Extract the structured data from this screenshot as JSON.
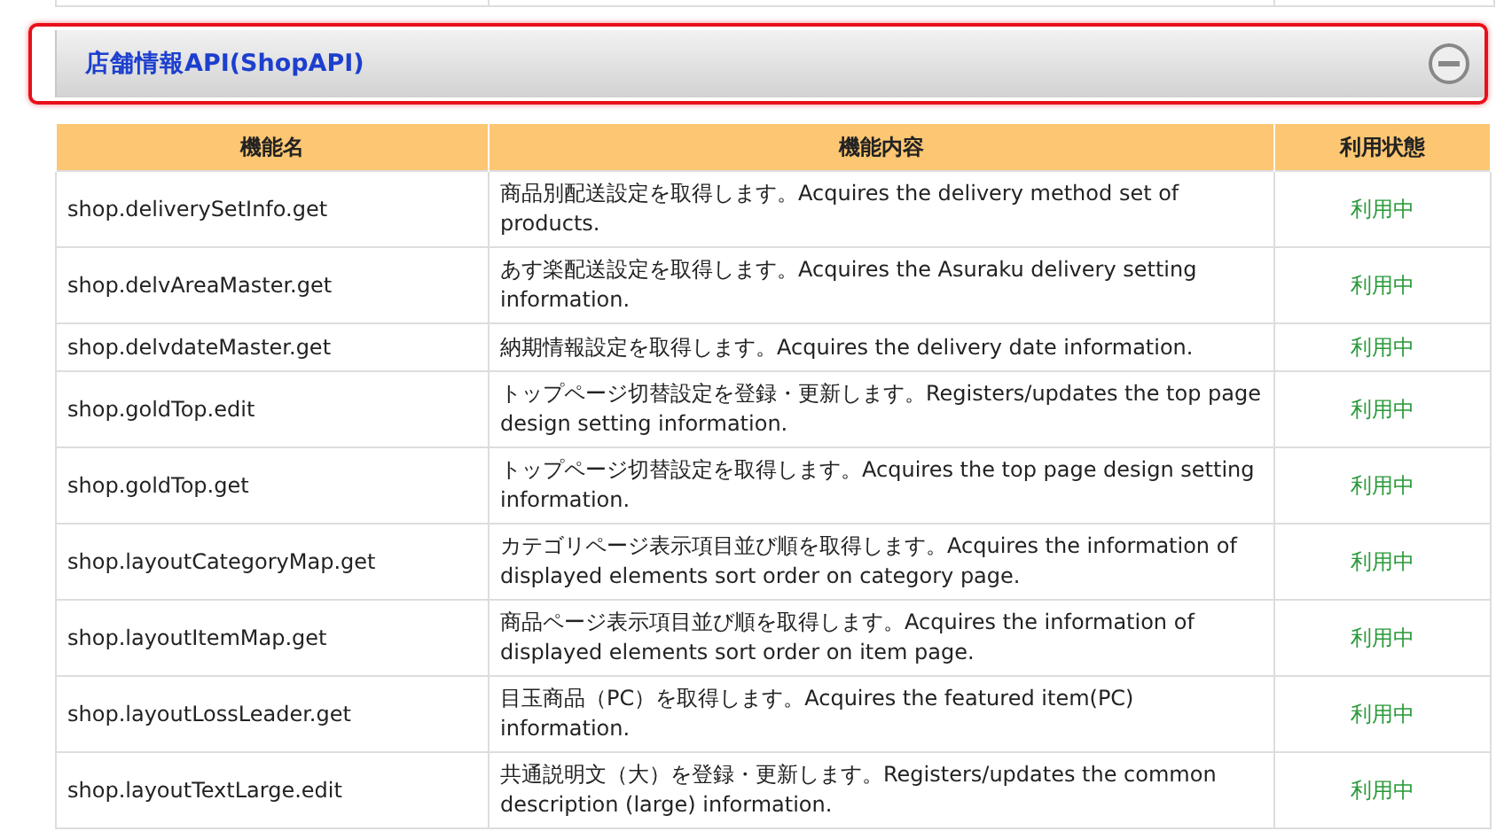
{
  "section": {
    "title": "店舗情報API(ShopAPI)",
    "expanded": true
  },
  "table": {
    "columns": [
      "機能名",
      "機能内容",
      "利用状態"
    ],
    "rows": [
      {
        "name": "shop.deliverySetInfo.get",
        "description": "商品別配送設定を取得します。Acquires the delivery method set of products.",
        "status": "利用中"
      },
      {
        "name": "shop.delvAreaMaster.get",
        "description": "あす楽配送設定を取得します。Acquires the Asuraku delivery setting information.",
        "status": "利用中"
      },
      {
        "name": "shop.delvdateMaster.get",
        "description": "納期情報設定を取得します。Acquires the delivery date information.",
        "status": "利用中"
      },
      {
        "name": "shop.goldTop.edit",
        "description": "トップページ切替設定を登録・更新します。Registers/updates the top page design setting information.",
        "status": "利用中"
      },
      {
        "name": "shop.goldTop.get",
        "description": "トップページ切替設定を取得します。Acquires the top page design setting information.",
        "status": "利用中"
      },
      {
        "name": "shop.layoutCategoryMap.get",
        "description": "カテゴリページ表示項目並び順を取得します。Acquires the information of displayed elements sort order on category page.",
        "status": "利用中"
      },
      {
        "name": "shop.layoutItemMap.get",
        "description": "商品ページ表示項目並び順を取得します。Acquires the information of displayed elements sort order on item page.",
        "status": "利用中"
      },
      {
        "name": "shop.layoutLossLeader.get",
        "description": "目玉商品（PC）を取得します。Acquires the featured item(PC) information.",
        "status": "利用中"
      },
      {
        "name": "shop.layoutTextLarge.edit",
        "description": "共通説明文（大）を登録・更新します。Registers/updates the common description (large) information.",
        "status": "利用中"
      }
    ]
  }
}
